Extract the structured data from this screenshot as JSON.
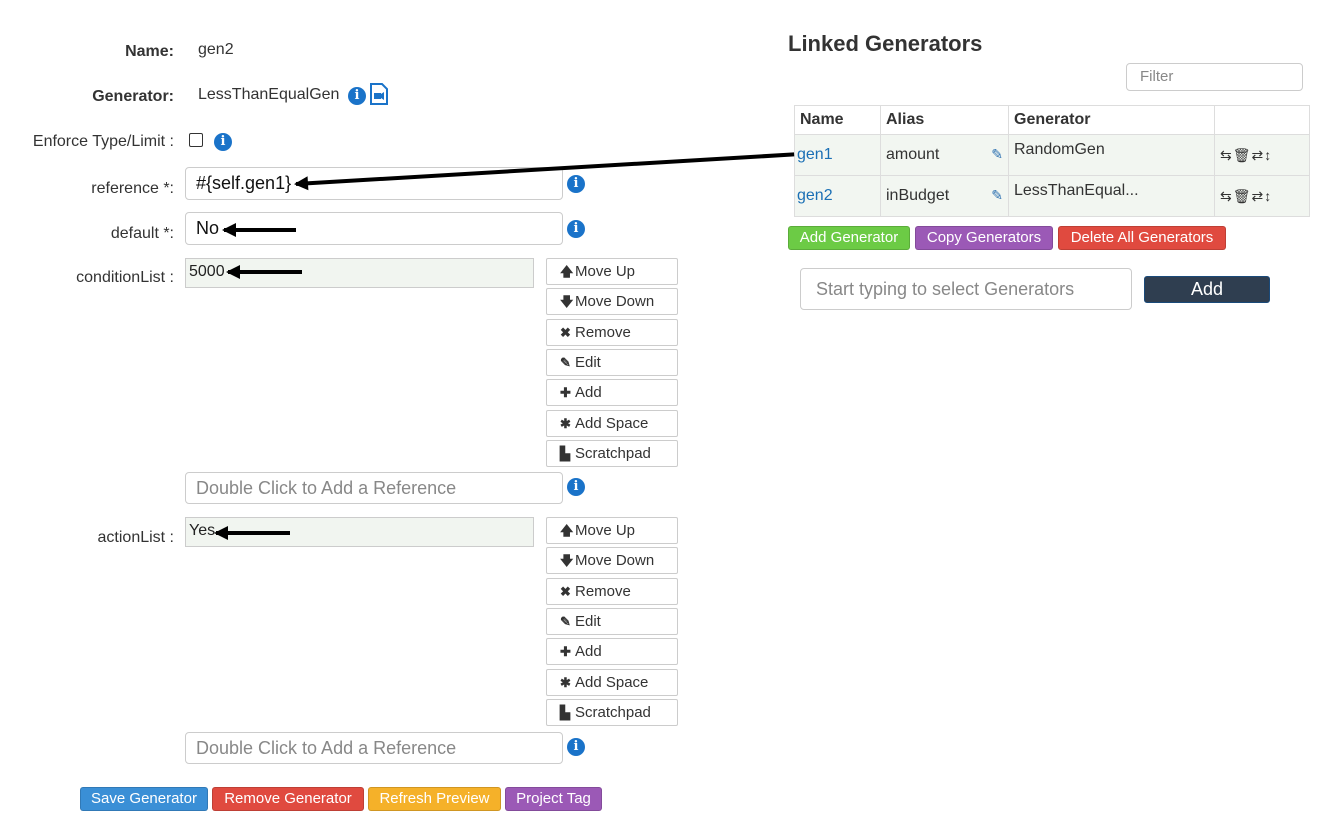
{
  "form": {
    "name_label": "Name:",
    "name_value": "gen2",
    "generator_label": "Generator:",
    "generator_value": "LessThanEqualGen",
    "enforce_label": "Enforce Type/Limit :",
    "reference_label": "reference *:",
    "reference_value": "#{self.gen1}",
    "default_label": "default *:",
    "default_value": "No",
    "condition_label": "conditionList :",
    "condition_items": [
      "5000"
    ],
    "condition_ref_placeholder": "Double Click to Add a Reference",
    "action_label": "actionList :",
    "action_items": [
      "Yes"
    ],
    "action_ref_placeholder": "Double Click to Add a Reference"
  },
  "list_buttons": {
    "move_up": "Move Up",
    "move_down": "Move Down",
    "remove": "Remove",
    "edit": "Edit",
    "add": "Add",
    "add_space": "Add Space",
    "scratchpad": "Scratchpad"
  },
  "footer": {
    "save": "Save Generator",
    "remove": "Remove Generator",
    "refresh": "Refresh Preview",
    "project_tag": "Project Tag"
  },
  "linked": {
    "title": "Linked Generators",
    "filter_placeholder": "Filter",
    "columns": [
      "Name",
      "Alias",
      "Generator"
    ],
    "rows": [
      {
        "name": "gen1",
        "alias": "amount",
        "generator": "RandomGen"
      },
      {
        "name": "gen2",
        "alias": "inBudget",
        "generator": "LessThanEqual..."
      }
    ],
    "add_generator": "Add Generator",
    "copy_generators": "Copy Generators",
    "delete_all": "Delete All Generators",
    "select_placeholder": "Start typing to select Generators",
    "add": "Add"
  },
  "colors": {
    "info_blue": "#1a73c9",
    "save": "#3a8fd6",
    "remove": "#e04a3f",
    "refresh": "#f5b129",
    "purple": "#9b59b6",
    "green": "#6ccb45",
    "add_dark": "#2f3e50"
  },
  "icons": [
    "info-icon",
    "video-doc-icon",
    "arrow-up-icon",
    "arrow-down-icon",
    "times-icon",
    "pencil-icon",
    "plus-icon",
    "asterisk-icon",
    "file-icon",
    "swap-icon",
    "trash-icon",
    "exchange-icon",
    "updown-icon"
  ]
}
